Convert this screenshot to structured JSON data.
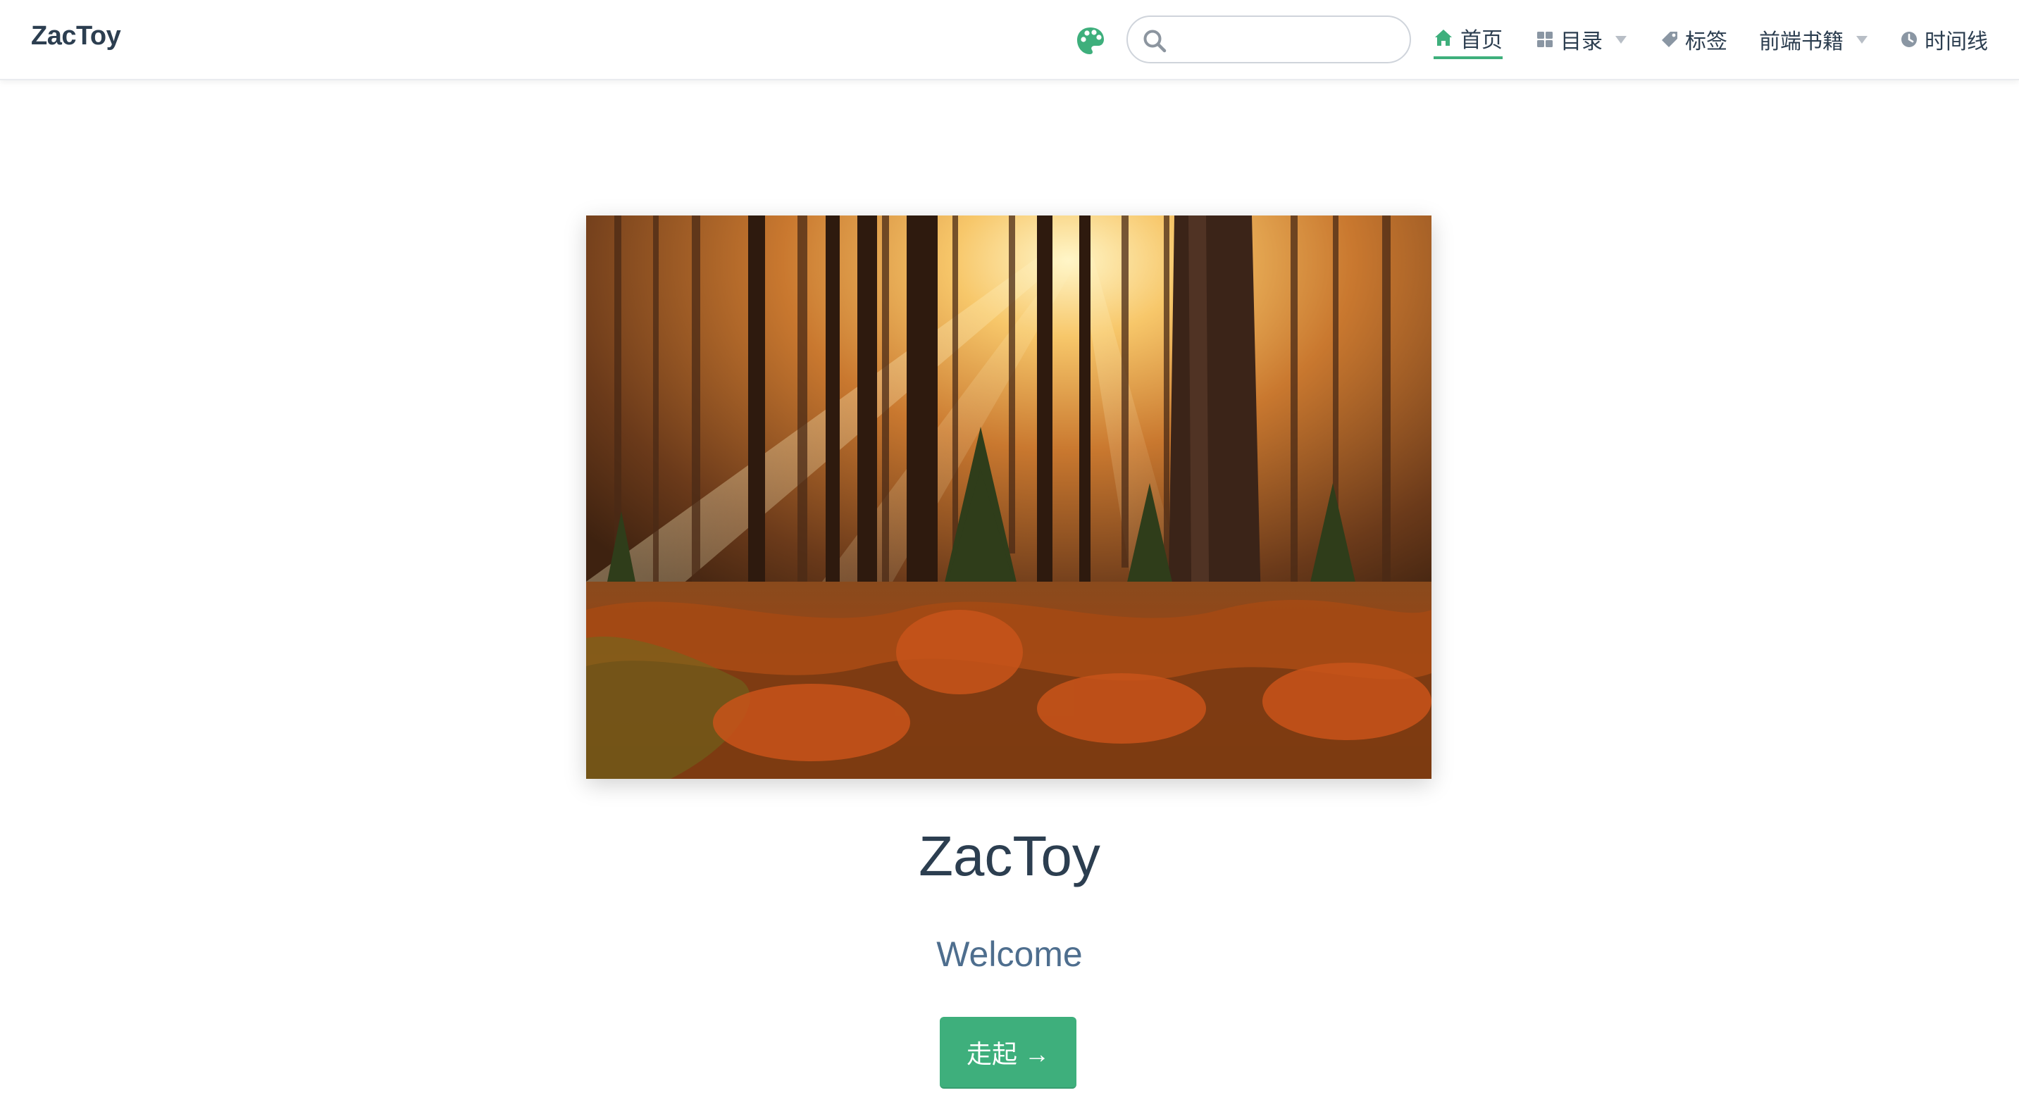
{
  "site": {
    "name": "ZacToy"
  },
  "search": {
    "value": "",
    "placeholder": ""
  },
  "nav": {
    "home": {
      "label": "首页",
      "icon": "home-icon"
    },
    "catalog": {
      "label": "目录",
      "icon": "grid-icon"
    },
    "tags": {
      "label": "标签",
      "icon": "tag-icon"
    },
    "books": {
      "label": "前端书籍"
    },
    "timeline": {
      "label": "时间线",
      "icon": "clock-icon"
    }
  },
  "hero": {
    "image": "sunlit-forest-image",
    "title": "ZacToy",
    "description": "Welcome",
    "action_label": "走起 →"
  },
  "colors": {
    "accent": "#3eaf7c",
    "text": "#2c3e50",
    "description": "#4e6e8e"
  }
}
